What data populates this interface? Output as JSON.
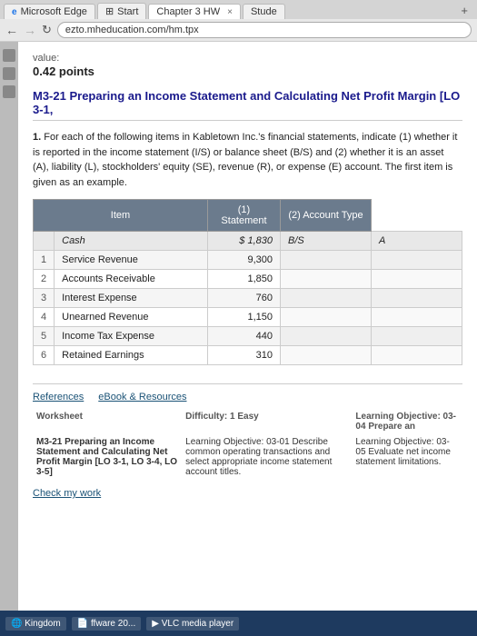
{
  "browser": {
    "tabs": [
      {
        "label": "Microsoft Edge",
        "active": false,
        "icon": "e"
      },
      {
        "label": "Start",
        "active": false
      },
      {
        "label": "Chapter 3 HW",
        "active": true
      },
      {
        "label": "Stude",
        "active": false
      }
    ],
    "address": "ezto.mheducation.com/hm.tpx",
    "close_icon": "×"
  },
  "page": {
    "value_label": "value:",
    "points": "0.42 points",
    "question_title": "M3-21 Preparing an Income Statement and Calculating Net Profit Margin [LO 3-1,",
    "question_number": "1.",
    "question_body": "For each of the following items in Kabletown Inc.'s financial statements, indicate (1) whether it is reported in the income statement (I/S) or balance sheet (B/S) and (2) whether it is an asset (A), liability (L), stockholders' equity (SE), revenue (R), or expense (E) account. The first item is given as an example.",
    "table": {
      "headers": [
        "Item",
        "(1) Statement",
        "(2) Account Type"
      ],
      "rows": [
        {
          "num": "",
          "item": "Cash",
          "value": "$ 1,830",
          "statement": "B/S",
          "account": "A",
          "example": true
        },
        {
          "num": "1",
          "item": "Service Revenue",
          "value": "9,300",
          "statement": "",
          "account": ""
        },
        {
          "num": "2",
          "item": "Accounts Receivable",
          "value": "1,850",
          "statement": "",
          "account": ""
        },
        {
          "num": "3",
          "item": "Interest Expense",
          "value": "760",
          "statement": "",
          "account": ""
        },
        {
          "num": "4",
          "item": "Unearned Revenue",
          "value": "1,150",
          "statement": "",
          "account": ""
        },
        {
          "num": "5",
          "item": "Income Tax Expense",
          "value": "440",
          "statement": "",
          "account": ""
        },
        {
          "num": "6",
          "item": "Retained Earnings",
          "value": "310",
          "statement": "",
          "account": ""
        }
      ]
    },
    "references": {
      "label": "References",
      "ebook_label": "eBook & Resources",
      "worksheet_label": "Worksheet",
      "difficulty_label": "Difficulty: 1 Easy",
      "learning_obj_label": "Learning Objective: 03-04 Prepare an",
      "worksheet_desc_title": "M3-21 Preparing an Income Statement and Calculating Net Profit Margin [LO 3-1, LO 3-4, LO 3-5]",
      "worksheet_desc": "Learning Objective: 03-01 Describe common operating transactions and select appropriate income statement account titles.",
      "learning_obj2": "Learning Objective: 03-05 Evaluate net income statement limitations."
    },
    "check_link": "Check my work"
  },
  "taskbar": {
    "items": [
      "Kingdom",
      "ffware 20...",
      "VLC media player"
    ]
  }
}
